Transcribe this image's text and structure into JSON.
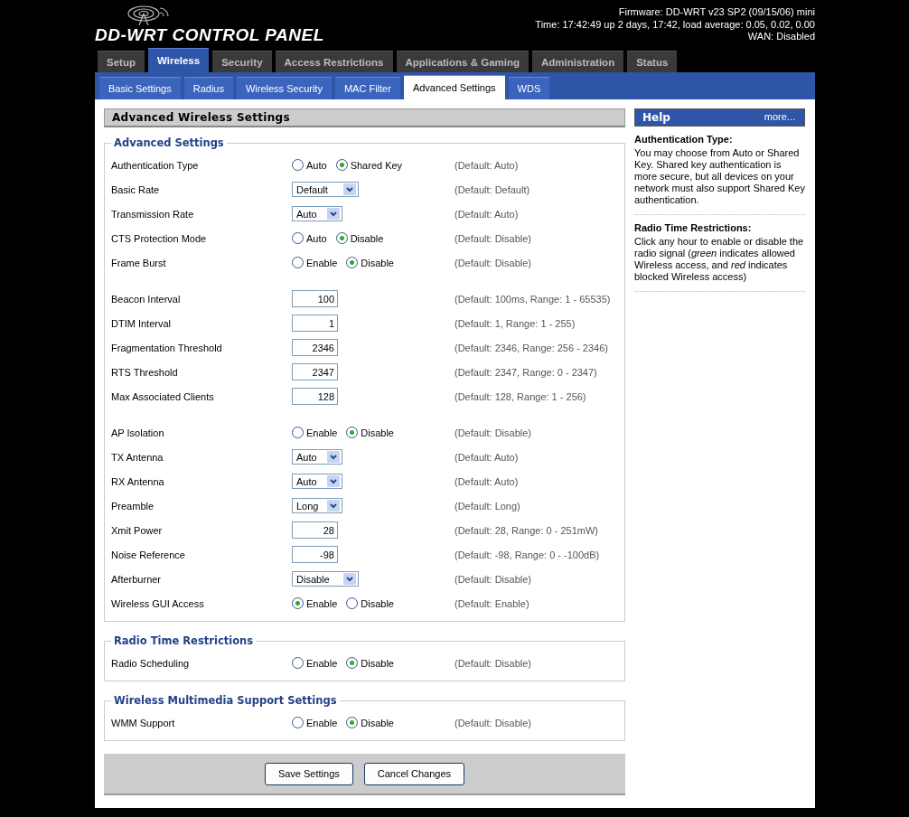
{
  "logo": {
    "text": "DD-WRT CONTROL PANEL"
  },
  "status": [
    "Firmware: DD-WRT v23 SP2 (09/15/06) mini",
    "Time: 17:42:49 up 2 days, 17:42, load average: 0.05, 0.02, 0.00",
    "WAN: Disabled"
  ],
  "main_tabs": [
    {
      "label": "Setup",
      "selected": false
    },
    {
      "label": "Wireless",
      "selected": true
    },
    {
      "label": "Security",
      "selected": false
    },
    {
      "label": "Access Restrictions",
      "selected": false
    },
    {
      "label": "Applications & Gaming",
      "selected": false
    },
    {
      "label": "Administration",
      "selected": false
    },
    {
      "label": "Status",
      "selected": false
    }
  ],
  "sub_tabs": [
    {
      "label": "Basic Settings",
      "selected": false
    },
    {
      "label": "Radius",
      "selected": false
    },
    {
      "label": "Wireless Security",
      "selected": false
    },
    {
      "label": "MAC Filter",
      "selected": false
    },
    {
      "label": "Advanced Settings",
      "selected": true
    },
    {
      "label": "WDS",
      "selected": false
    }
  ],
  "page_title": "Advanced Wireless Settings",
  "fieldsets": [
    {
      "legend": "Advanced Settings",
      "groups": [
        [
          {
            "kind": "radio",
            "label": "Authentication Type",
            "options": [
              {
                "label": "Auto",
                "selected": false
              },
              {
                "label": "Shared Key",
                "selected": true
              }
            ],
            "default": "(Default: Auto)"
          },
          {
            "kind": "select",
            "label": "Basic Rate",
            "value": "Default",
            "default": "(Default: Default)"
          },
          {
            "kind": "select",
            "label": "Transmission Rate",
            "value": "Auto",
            "default": "(Default: Auto)"
          },
          {
            "kind": "radio",
            "label": "CTS Protection Mode",
            "options": [
              {
                "label": "Auto",
                "selected": false
              },
              {
                "label": "Disable",
                "selected": true
              }
            ],
            "default": "(Default: Disable)"
          },
          {
            "kind": "radio",
            "label": "Frame Burst",
            "options": [
              {
                "label": "Enable",
                "selected": false
              },
              {
                "label": "Disable",
                "selected": true
              }
            ],
            "default": "(Default: Disable)"
          }
        ],
        [
          {
            "kind": "text",
            "label": "Beacon Interval",
            "value": "100",
            "default": "(Default: 100ms, Range: 1 - 65535)"
          },
          {
            "kind": "text",
            "label": "DTIM Interval",
            "value": "1",
            "default": "(Default: 1, Range: 1 - 255)"
          },
          {
            "kind": "text",
            "label": "Fragmentation Threshold",
            "value": "2346",
            "default": "(Default: 2346, Range: 256 - 2346)"
          },
          {
            "kind": "text",
            "label": "RTS Threshold",
            "value": "2347",
            "default": "(Default: 2347, Range: 0 - 2347)"
          },
          {
            "kind": "text",
            "label": "Max Associated Clients",
            "value": "128",
            "default": "(Default: 128, Range: 1 - 256)"
          }
        ],
        [
          {
            "kind": "radio",
            "label": "AP Isolation",
            "options": [
              {
                "label": "Enable",
                "selected": false
              },
              {
                "label": "Disable",
                "selected": true
              }
            ],
            "default": "(Default: Disable)"
          },
          {
            "kind": "select",
            "label": "TX Antenna",
            "value": "Auto",
            "default": "(Default: Auto)"
          },
          {
            "kind": "select",
            "label": "RX Antenna",
            "value": "Auto",
            "default": "(Default: Auto)"
          },
          {
            "kind": "select",
            "label": "Preamble",
            "value": "Long",
            "default": "(Default: Long)"
          },
          {
            "kind": "text",
            "label": "Xmit Power",
            "value": "28",
            "default": "(Default: 28, Range: 0 - 251mW)"
          },
          {
            "kind": "text",
            "label": "Noise Reference",
            "value": "-98",
            "default": "(Default: -98, Range: 0 - -100dB)"
          },
          {
            "kind": "select",
            "label": "Afterburner",
            "value": "Disable",
            "default": "(Default: Disable)"
          },
          {
            "kind": "radio",
            "label": "Wireless GUI Access",
            "options": [
              {
                "label": "Enable",
                "selected": true
              },
              {
                "label": "Disable",
                "selected": false
              }
            ],
            "default": "(Default: Enable)"
          }
        ]
      ]
    },
    {
      "legend": "Radio Time Restrictions",
      "groups": [
        [
          {
            "kind": "radio",
            "label": "Radio Scheduling",
            "options": [
              {
                "label": "Enable",
                "selected": false
              },
              {
                "label": "Disable",
                "selected": true
              }
            ],
            "default": "(Default: Disable)"
          }
        ]
      ]
    },
    {
      "legend": "Wireless Multimedia Support Settings",
      "groups": [
        [
          {
            "kind": "radio",
            "label": "WMM Support",
            "options": [
              {
                "label": "Enable",
                "selected": false
              },
              {
                "label": "Disable",
                "selected": true
              }
            ],
            "default": "(Default: Disable)"
          }
        ]
      ]
    }
  ],
  "buttons": [
    "Save Settings",
    "Cancel Changes"
  ],
  "help": {
    "title": "Help",
    "more": "more...",
    "sections": [
      {
        "title": "Authentication Type:",
        "text": "You may choose from Auto or Shared Key. Shared key authentication is more secure, but all devices on your network must also support Shared Key authentication."
      },
      {
        "title": "Radio Time Restrictions:",
        "text": "Click any hour to enable or disable the radio signal (*green* indicates allowed Wireless access, and *red* indicates blocked Wireless access)"
      }
    ]
  }
}
